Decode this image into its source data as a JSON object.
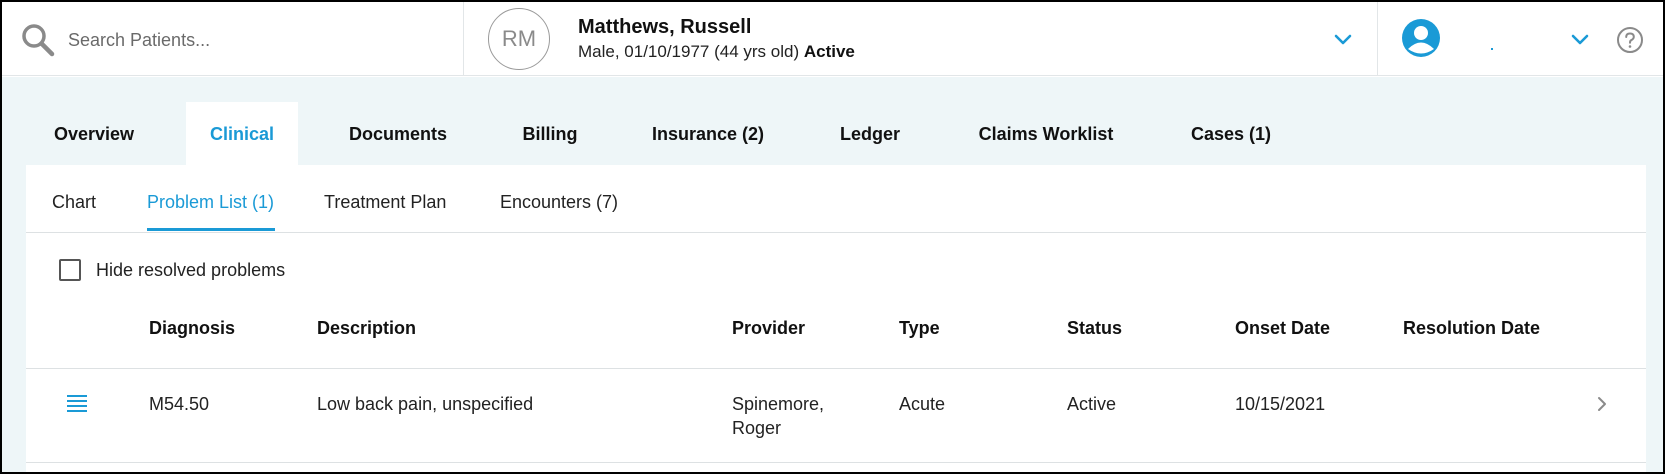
{
  "search": {
    "placeholder": "Search Patients..."
  },
  "patient": {
    "initials": "RM",
    "name": "Matthews, Russell",
    "info": "Male, 01/10/1977 (44 yrs old) ",
    "status": "Active"
  },
  "tabs": [
    {
      "label": "Overview"
    },
    {
      "label": "Clinical"
    },
    {
      "label": "Documents"
    },
    {
      "label": "Billing"
    },
    {
      "label": "Insurance (2)"
    },
    {
      "label": "Ledger"
    },
    {
      "label": "Claims Worklist"
    },
    {
      "label": "Cases (1)"
    }
  ],
  "subtabs": [
    {
      "label": "Chart"
    },
    {
      "label": "Problem List (1)"
    },
    {
      "label": "Treatment Plan"
    },
    {
      "label": "Encounters (7)"
    }
  ],
  "filter": {
    "hide_resolved_label": "Hide resolved problems"
  },
  "table": {
    "headers": [
      "Diagnosis",
      "Description",
      "Provider",
      "Type",
      "Status",
      "Onset Date",
      "Resolution Date"
    ],
    "rows": [
      {
        "diagnosis": "M54.50",
        "description": "Low back pain, unspecified",
        "provider_line1": "Spinemore,",
        "provider_line2": "Roger",
        "type": "Acute",
        "status": "Active",
        "onset_date": "10/15/2021",
        "resolution_date": ""
      }
    ]
  },
  "colors": {
    "accent": "#1a9ad6",
    "tab_bg": "#eef6f8"
  },
  "icons": [
    "search-icon",
    "chevron-down-icon",
    "user-avatar-icon",
    "help-icon",
    "list-icon",
    "chevron-right-icon"
  ]
}
